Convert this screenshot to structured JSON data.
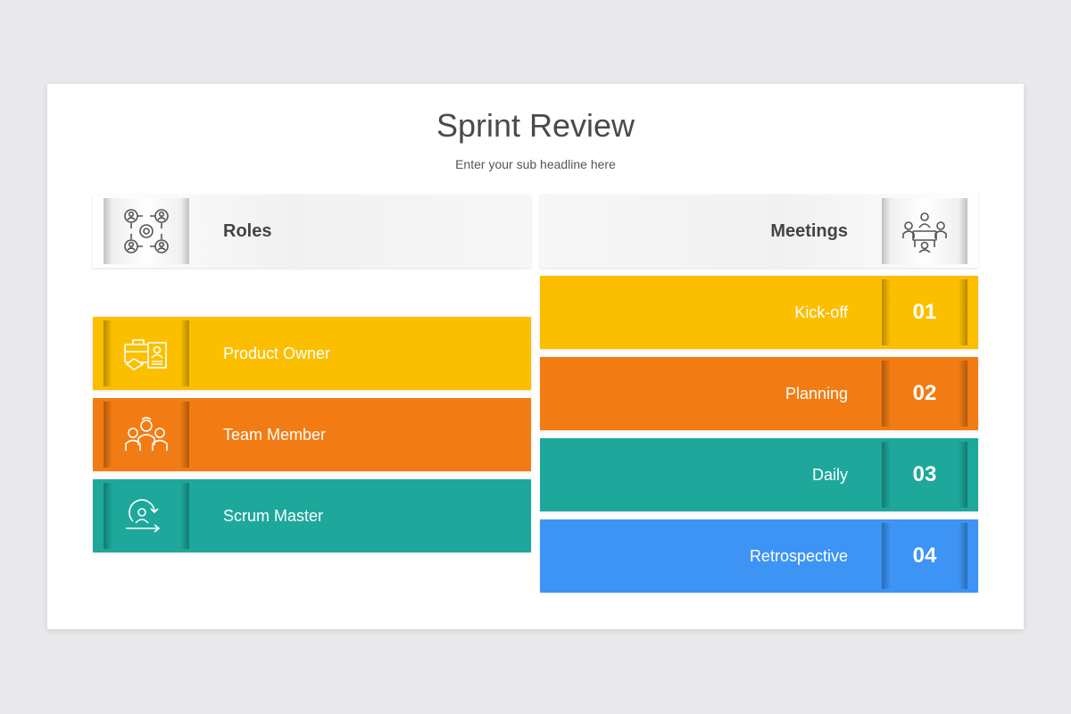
{
  "title": "Sprint Review",
  "subtitle": "Enter your sub headline here",
  "roles": {
    "header": {
      "label": "Roles",
      "icon": "team-network-icon"
    },
    "items": [
      {
        "label": "Product Owner",
        "icon": "briefcase-profile-icon",
        "color": "#fcbf00"
      },
      {
        "label": "Team Member",
        "icon": "team-group-icon",
        "color": "#f27c13"
      },
      {
        "label": "Scrum Master",
        "icon": "agile-cycle-icon",
        "color": "#1da89b"
      }
    ]
  },
  "meetings": {
    "header": {
      "label": "Meetings",
      "icon": "meeting-table-icon"
    },
    "items": [
      {
        "label": "Kick-off",
        "number": "01",
        "color": "#fcbf00"
      },
      {
        "label": "Planning",
        "number": "02",
        "color": "#f27c13"
      },
      {
        "label": "Daily",
        "number": "03",
        "color": "#1da89b"
      },
      {
        "label": "Retrospective",
        "number": "04",
        "color": "#3d94f4"
      }
    ]
  }
}
